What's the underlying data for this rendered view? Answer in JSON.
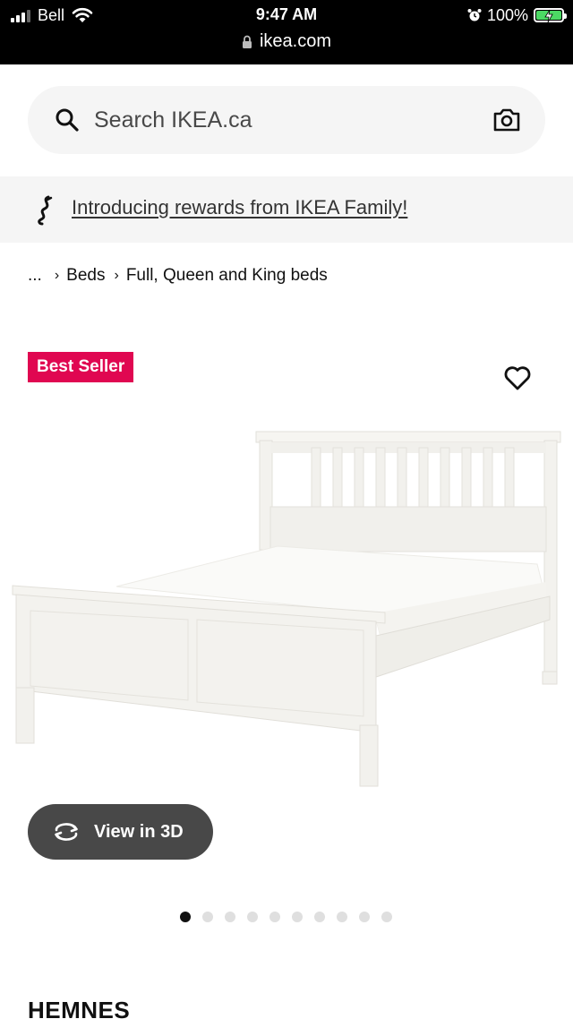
{
  "status_bar": {
    "carrier": "Bell",
    "time": "9:47 AM",
    "battery": "100%",
    "url": "ikea.com"
  },
  "search": {
    "placeholder": "Search IKEA.ca",
    "icon": "search-icon",
    "camera_icon": "camera-icon"
  },
  "promo": {
    "text": "Introducing rewards from IKEA Family!",
    "icon": "ikea-family-icon"
  },
  "breadcrumb": {
    "items": [
      "...",
      "Beds",
      "Full, Queen and King beds"
    ]
  },
  "product": {
    "badge": "Best Seller",
    "view_3d_label": "View in 3D",
    "title": "HEMNES",
    "image_count": 10,
    "active_image": 1
  },
  "colors": {
    "badge_bg": "#e00751",
    "button_bg": "#484848",
    "search_bg": "#f5f5f5",
    "battery_fill": "#4cd964"
  }
}
